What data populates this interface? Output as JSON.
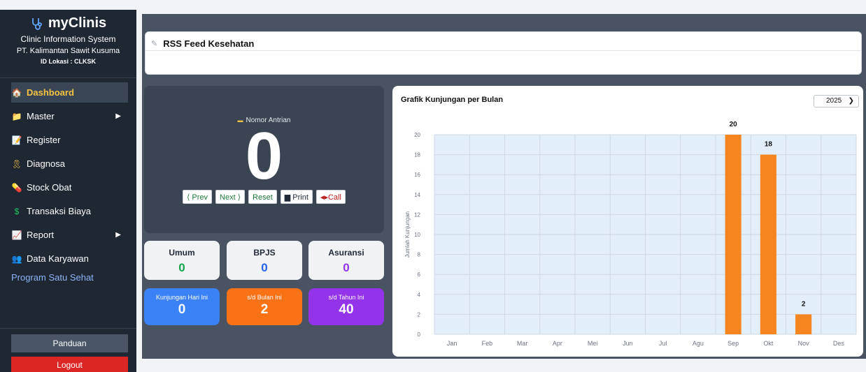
{
  "brand": {
    "name": "myClinis",
    "subtitle": "Clinic Information System",
    "company": "PT. Kalimantan Sawit Kusuma",
    "location": "ID Lokasi : CLKSK"
  },
  "menu": [
    {
      "label": "Dashboard",
      "icon": "home-icon",
      "glyph": "🏠",
      "color": "#f6c343",
      "active": true
    },
    {
      "label": "Master",
      "icon": "folder-icon",
      "glyph": "📁",
      "color": "#f6c343",
      "arrow": "▶"
    },
    {
      "label": "Register",
      "icon": "register-icon",
      "glyph": "📝",
      "color": "#f28b49"
    },
    {
      "label": "Diagnosa",
      "icon": "ribbon-icon",
      "glyph": "🎗",
      "color": "#f6c343"
    },
    {
      "label": "Stock Obat",
      "icon": "pill-icon",
      "glyph": "💊",
      "color": "#f6a343"
    },
    {
      "label": "Transaksi Biaya",
      "icon": "dollar-icon",
      "glyph": "$",
      "color": "#22c55e"
    },
    {
      "label": "Report",
      "icon": "chart-icon",
      "glyph": "📈",
      "color": "#60a5fa",
      "arrow": "▶"
    },
    {
      "label": "Data Karyawan",
      "icon": "people-icon",
      "glyph": "👥",
      "color": "#f6c343"
    }
  ],
  "menu_extra": "Program Satu Sehat",
  "footer": {
    "panduan": "Panduan",
    "logout": "Logout"
  },
  "rss": {
    "title": "RSS Feed Kesehatan"
  },
  "queue": {
    "label": "Nomor Antrian",
    "number": "0",
    "buttons": {
      "prev": "⟨ Prev",
      "next": "Next ⟩",
      "reset": "Reset",
      "print": "Print",
      "call": "Call"
    }
  },
  "counts": {
    "umum": {
      "label": "Umum",
      "value": "0",
      "color": "#16a34a"
    },
    "bpjs": {
      "label": "BPJS",
      "value": "0",
      "color": "#2563eb"
    },
    "asuransi": {
      "label": "Asuransi",
      "value": "0",
      "color": "#9333ea"
    }
  },
  "stats": {
    "hari": {
      "label": "Kunjungan Hari Ini",
      "value": "0",
      "color": "#3b82f6"
    },
    "bulan": {
      "label": "s/d Bulan Ini",
      "value": "2",
      "color": "#f97316"
    },
    "tahun": {
      "label": "s/d Tahun Ini",
      "value": "40",
      "color": "#9333ea"
    }
  },
  "year_select": "2025",
  "chart_data": {
    "type": "bar",
    "title": "Grafik Kunjungan per Bulan",
    "ylabel": "Jumlah Kunjungan",
    "categories": [
      "Jan",
      "Feb",
      "Mar",
      "Apr",
      "Mei",
      "Jun",
      "Jul",
      "Agu",
      "Sep",
      "Okt",
      "Nov",
      "Des"
    ],
    "values": [
      0,
      0,
      0,
      0,
      0,
      0,
      0,
      0,
      20,
      18,
      2,
      0
    ],
    "ylim": [
      0,
      20
    ],
    "yticks": [
      0,
      2,
      4,
      6,
      8,
      10,
      12,
      14,
      16,
      18,
      20
    ],
    "bar_color": "#f5851f",
    "grid": true,
    "data_labels": true
  }
}
